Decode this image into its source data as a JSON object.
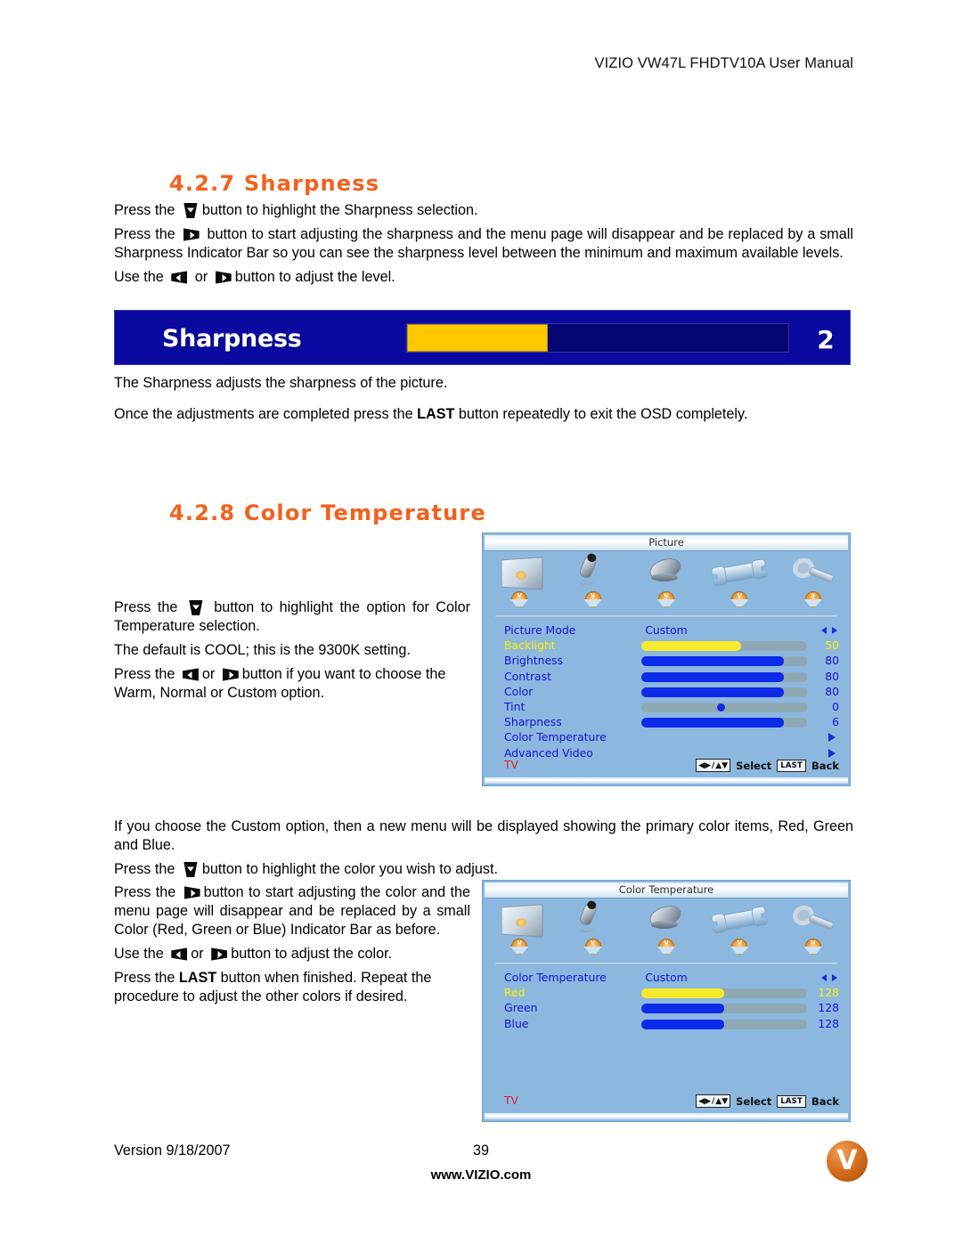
{
  "header": {
    "title": "VIZIO VW47L FHDTV10A User Manual"
  },
  "sections": {
    "sharpness": {
      "heading": "4.2.7 Sharpness",
      "p1_pre": "Press the ",
      "p1_post": "button to highlight the Sharpness selection.",
      "p2_pre": "Press the ",
      "p2_post": "button to start adjusting the sharpness and the menu page will disappear and be replaced by a small Sharpness Indicator Bar so you can see the sharpness level between the minimum and maximum available levels.",
      "p3_pre": "Use the ",
      "p3_mid": " or ",
      "p3_post": "button to adjust the level.",
      "p4": "The Sharpness adjusts the sharpness of the picture.",
      "p5_pre": "Once the adjustments are completed press the ",
      "p5_key": "LAST",
      "p5_post": " button repeatedly to exit the OSD completely."
    },
    "color_temperature": {
      "heading": "4.2.8 Color Temperature",
      "p1_pre": "Press the ",
      "p1_post": "button to highlight the option for Color Temperature selection.",
      "p2": "The default is COOL; this is the 9300K setting.",
      "p3_pre": "Press the ",
      "p3_mid": "or ",
      "p3_post": "button if you want to choose the Warm, Normal or Custom option.",
      "p4": "If you choose the Custom option, then a new menu will be displayed showing the primary color items, Red, Green and Blue.",
      "p5_pre": "Press the ",
      "p5_post": "button to highlight the color you wish to adjust.",
      "p6_pre": "Press the ",
      "p6_post": "button to start adjusting the color and the menu page will disappear and be replaced by a small Color (Red, Green or Blue) Indicator Bar as before.",
      "p7_pre": "Use the ",
      "p7_mid": "or ",
      "p7_post": "button to adjust the color.",
      "p8_pre": "Press the ",
      "p8_key": "LAST",
      "p8_post": " button when finished.  Repeat the procedure to adjust the other colors if desired."
    }
  },
  "sharpness_indicator": {
    "label": "Sharpness",
    "value": "2",
    "fill_percent": 37,
    "bar_color": "#FFC800",
    "background_color": "#0a0aa0",
    "text_color": "#ffffff"
  },
  "osd_picture": {
    "title": "Picture",
    "tabs": [
      {
        "name": "picture-tab",
        "icon": "tv-screen-icon",
        "badge": "V"
      },
      {
        "name": "audio-tab",
        "icon": "microphone-icon",
        "badge": "V"
      },
      {
        "name": "tuner-tab",
        "icon": "satellite-dish-icon",
        "badge": "V"
      },
      {
        "name": "setup-tab",
        "icon": "wrench-icon",
        "badge": "V"
      },
      {
        "name": "parental-tab",
        "icon": "key-icon",
        "badge": "V"
      }
    ],
    "rows": [
      {
        "label": "Picture Mode",
        "type": "mode",
        "value": "Custom",
        "control": "lr-arrows"
      },
      {
        "label": "Backlight",
        "type": "slider",
        "value": "50",
        "fill_percent": 60,
        "selected": true
      },
      {
        "label": "Brightness",
        "type": "slider",
        "value": "80",
        "fill_percent": 86,
        "selected": false
      },
      {
        "label": "Contrast",
        "type": "slider",
        "value": "80",
        "fill_percent": 86,
        "selected": false
      },
      {
        "label": "Color",
        "type": "slider",
        "value": "80",
        "fill_percent": 86,
        "selected": false
      },
      {
        "label": "Tint",
        "type": "knob",
        "value": "0",
        "knob_percent": 48,
        "selected": false
      },
      {
        "label": "Sharpness",
        "type": "slider",
        "value": "6",
        "fill_percent": 86,
        "selected": false
      },
      {
        "label": "Color Temperature",
        "type": "submenu",
        "value": "",
        "control": "r-arrow"
      },
      {
        "label": "Advanced Video",
        "type": "submenu",
        "value": "",
        "control": "r-arrow"
      }
    ],
    "footer": {
      "source": "TV",
      "nav_hint": "Select",
      "last_key": "LAST",
      "back_hint": "Back"
    }
  },
  "osd_color_temperature": {
    "title": "Color Temperature",
    "tabs": [
      {
        "name": "picture-tab",
        "icon": "tv-screen-icon",
        "badge": "V"
      },
      {
        "name": "audio-tab",
        "icon": "microphone-icon",
        "badge": "V"
      },
      {
        "name": "tuner-tab",
        "icon": "satellite-dish-icon",
        "badge": "V"
      },
      {
        "name": "setup-tab",
        "icon": "wrench-icon",
        "badge": "V"
      },
      {
        "name": "parental-tab",
        "icon": "key-icon",
        "badge": "V"
      }
    ],
    "rows": [
      {
        "label": "Color Temperature",
        "type": "mode",
        "value": "Custom",
        "control": "lr-arrows"
      },
      {
        "label": "Red",
        "type": "slider",
        "value": "128",
        "fill_percent": 50,
        "selected": true
      },
      {
        "label": "Green",
        "type": "slider",
        "value": "128",
        "fill_percent": 50,
        "selected": false
      },
      {
        "label": "Blue",
        "type": "slider",
        "value": "128",
        "fill_percent": 50,
        "selected": false
      }
    ],
    "footer": {
      "source": "TV",
      "nav_hint": "Select",
      "last_key": "LAST",
      "back_hint": "Back"
    }
  },
  "footer": {
    "version": "Version 9/18/2007",
    "page_number": "39",
    "url": "www.VIZIO.com",
    "logo_letter": "V"
  },
  "colors": {
    "heading_orange": "#F4601C",
    "osd_background": "#8CB8E0",
    "osd_label_blue": "#1414CC",
    "osd_selected_yellow": "#FFF000",
    "osd_source_red": "#E02020",
    "slider_fill_blue": "#0D2AE8",
    "slider_track_gray": "#8fa9b4",
    "indicator_bar_blue": "#0a0aa0",
    "indicator_fill_yellow": "#FFC800"
  }
}
